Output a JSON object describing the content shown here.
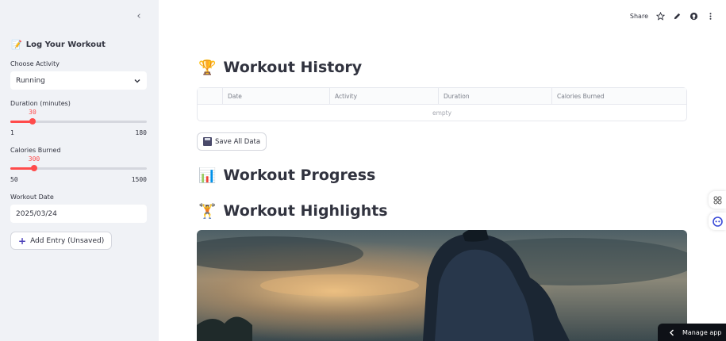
{
  "sidebar": {
    "collapse_glyph": "‹",
    "title_emoji": "📝",
    "title": "Log Your Workout",
    "activity_label": "Choose Activity",
    "activity_value": "Running",
    "duration_label": "Duration (minutes)",
    "duration": {
      "value": "30",
      "min": "1",
      "max": "180",
      "fraction": 0.162
    },
    "calories_label": "Calories Burned",
    "calories": {
      "value": "300",
      "min": "50",
      "max": "1500",
      "fraction": 0.1724
    },
    "date_label": "Workout Date",
    "date_value": "2025/03/24",
    "add_button": "Add Entry (Unsaved)"
  },
  "toolbar": {
    "share": "Share"
  },
  "main": {
    "history": {
      "emoji": "🏆",
      "title": "Workout History"
    },
    "table": {
      "columns": [
        "Date",
        "Activity",
        "Duration",
        "Calories Burned"
      ],
      "empty_text": "empty"
    },
    "save_button": "Save All Data",
    "progress": {
      "emoji": "📊",
      "title": "Workout Progress"
    },
    "highlights": {
      "emoji": "🏋️",
      "title": "Workout Highlights"
    }
  },
  "manage": {
    "label": "Manage app"
  },
  "colors": {
    "accent": "#ff4b4b",
    "sidebar_bg": "#f0f2f6",
    "text": "#31333f",
    "manage_bg": "#0e1117"
  }
}
